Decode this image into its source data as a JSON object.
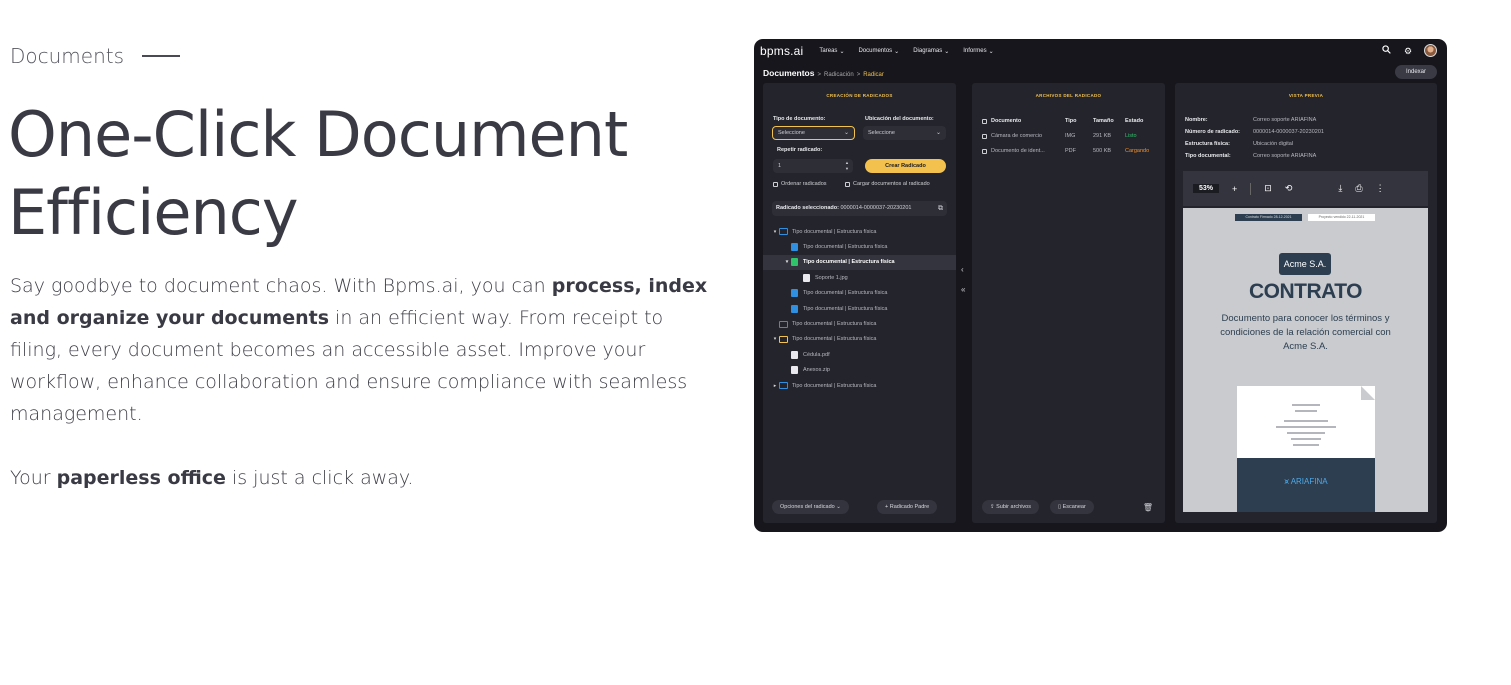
{
  "hero": {
    "eyebrow": "Documents",
    "headline_line1": "One-Click Document",
    "headline_line2": "Efficiency",
    "p1_a": "Say goodbye to document chaos. With Bpms.ai, you can ",
    "p1_b": "process, index and organize your documents",
    "p1_c": " in an efficient way. From receipt to filing, every document becomes an accessible asset. Improve your workflow, enhance collaboration and ensure compliance with seamless management.",
    "p2_a": "Your ",
    "p2_b": "paperless office",
    "p2_c": " is just a click away."
  },
  "app": {
    "logo": "bpms.ai",
    "nav": [
      "Tareas",
      "Documentos",
      "Diagramas",
      "Informes"
    ],
    "icons": {
      "search": "search-icon",
      "settings": "gear-icon",
      "avatar": "avatar"
    },
    "breadcrumb": {
      "root": "Documentos",
      "sep": ">",
      "mid": "Radicación",
      "current": "Radicar"
    },
    "index_button": "Indexar",
    "creation": {
      "title": "CREACIÓN DE RADICADOS",
      "doc_type_label": "Tipo de documento:",
      "doc_type_value": "Seleccione",
      "doc_location_label": "Ubicación del documento:",
      "doc_location_value": "Seleccione",
      "repeat_label": "Repetir radicado:",
      "repeat_value": "1",
      "create_button": "Crear Radicado",
      "order_checkbox": "Ordenar radicados",
      "load_checkbox": "Cargar documentos al radicado",
      "selected_label": "Radicado seleccionado:",
      "selected_value": "0000014-0000037-20230201",
      "tree": [
        {
          "label": "Tipo documental  |  Estructura física",
          "level": 0,
          "kind": "folder",
          "caret": "▾"
        },
        {
          "label": "Tipo documental  |  Estructura física",
          "level": 1,
          "kind": "doc",
          "caret": ""
        },
        {
          "label": "Tipo documental  |  Estructura física",
          "level": 1,
          "kind": "doc-green",
          "caret": "▾",
          "highlight": true
        },
        {
          "label": "Soporte 1.jpg",
          "level": 2,
          "kind": "img",
          "caret": ""
        },
        {
          "label": "Tipo documental  |  Estructura física",
          "level": 1,
          "kind": "doc",
          "caret": ""
        },
        {
          "label": "Tipo documental  |  Estructura física",
          "level": 1,
          "kind": "doc",
          "caret": ""
        },
        {
          "label": "Tipo documental  |  Estructura física",
          "level": 0,
          "kind": "folder",
          "caret": ""
        },
        {
          "label": "Tipo documental  |  Estructura física",
          "level": 0,
          "kind": "folder-gold",
          "caret": "▾"
        },
        {
          "label": "Cédula.pdf",
          "level": 1,
          "kind": "file",
          "caret": ""
        },
        {
          "label": "Anexos.zip",
          "level": 1,
          "kind": "file",
          "caret": ""
        },
        {
          "label": "Tipo documental  |  Estructura física",
          "level": 0,
          "kind": "folder",
          "caret": "▸"
        }
      ],
      "options_button": "Opciones del radicado",
      "parent_button": "Radicado Padre"
    },
    "files": {
      "title": "ARCHIVOS  DEL RADICADO",
      "headers": [
        "Documento",
        "Tipo",
        "Tamaño",
        "Estado"
      ],
      "rows": [
        {
          "name": "Cámara de comercio",
          "type": "IMG",
          "size": "291 KB",
          "status": "Listo"
        },
        {
          "name": "Documento de ident...",
          "type": "PDF",
          "size": "500 KB",
          "status": "Cargando"
        }
      ],
      "upload_button": "Subir archivos",
      "scan_button": "Escanear"
    },
    "preview": {
      "title": "VISTA PREVIA",
      "meta": [
        {
          "k": "Nombre:",
          "v": "Correo soporte ARIAFINA"
        },
        {
          "k": "Número de radicado:",
          "v": "0000014-0000037-20230201"
        },
        {
          "k": "Estructura física:",
          "v": "Ubicación digital"
        },
        {
          "k": "Tipo documental:",
          "v": "Correo soporte ARIAFINA"
        }
      ],
      "zoom": "53%",
      "doc_tab1": "Contrato Firmado 28-12-2021",
      "doc_tab2": "Proyecto vendido 22-11-2021",
      "company": "Acme S.A.",
      "doc_title": "CONTRATO",
      "doc_desc": "Documento para conocer los términos y condiciones de la relación comercial con Acme S.A.",
      "brand": "ARIAFINA"
    }
  },
  "colors": {
    "accent": "#f2c14e",
    "ok": "#2fc36a",
    "loading": "#f2922e",
    "panel": "#24242c",
    "frame": "#16161c",
    "doc_navy": "#2c3e50"
  }
}
